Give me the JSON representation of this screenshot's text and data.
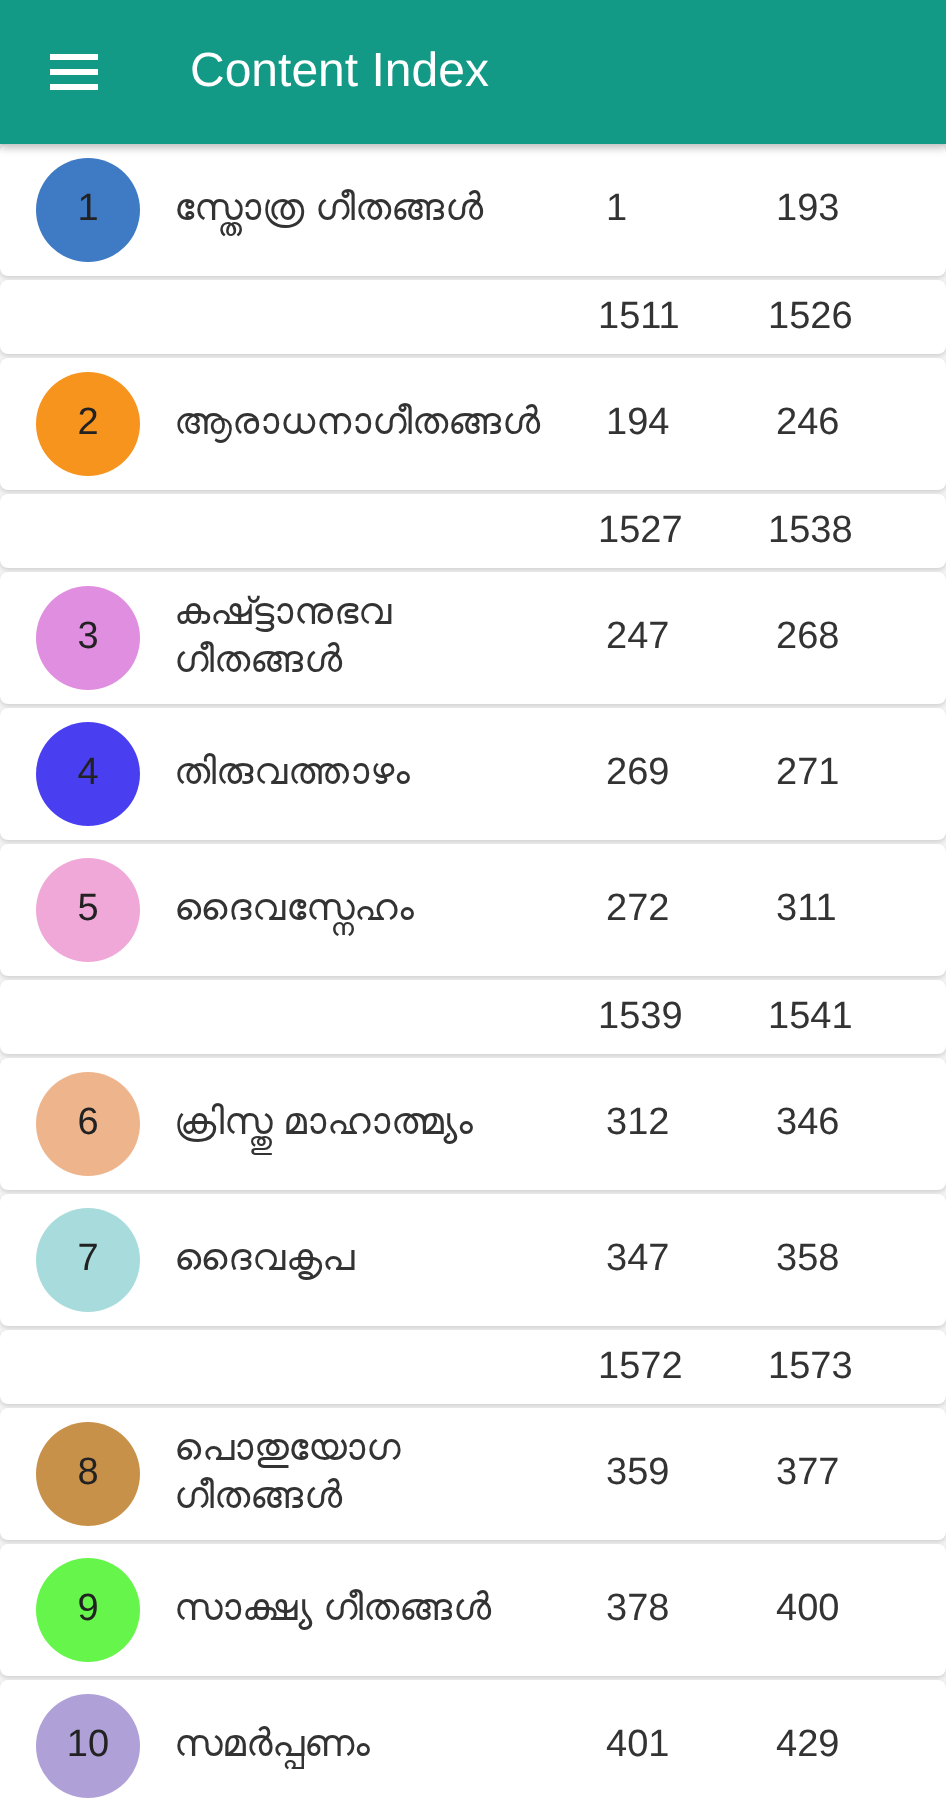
{
  "app_bar": {
    "title": "Content Index"
  },
  "rows": [
    {
      "kind": "category",
      "number": "1",
      "color": "#3f7bc4",
      "title": "സ്തോത്ര ഗീതങ്ങൾ",
      "start": "1",
      "end": "193"
    },
    {
      "kind": "extra",
      "start": "1511",
      "end": "1526"
    },
    {
      "kind": "category",
      "number": "2",
      "color": "#f7941d",
      "title": "ആരാധനാഗീതങ്ങൾ",
      "start": "194",
      "end": "246"
    },
    {
      "kind": "extra",
      "start": "1527",
      "end": "1538"
    },
    {
      "kind": "category",
      "number": "3",
      "color": "#e08ee0",
      "title": "കഷ്ട്ടാനുഭവ ഗീതങ്ങൾ",
      "start": "247",
      "end": "268"
    },
    {
      "kind": "category",
      "number": "4",
      "color": "#4a3ff0",
      "title": "തിരുവത്താഴം",
      "start": "269",
      "end": "271"
    },
    {
      "kind": "category",
      "number": "5",
      "color": "#f0a8d8",
      "title": "ദൈവസ്നേഹം",
      "start": "272",
      "end": "311"
    },
    {
      "kind": "extra",
      "start": "1539",
      "end": "1541"
    },
    {
      "kind": "category",
      "number": "6",
      "color": "#eeb48c",
      "title": "ക്രിസ്തു മാഹാത്മ്യം",
      "start": "312",
      "end": "346"
    },
    {
      "kind": "category",
      "number": "7",
      "color": "#a8dcdc",
      "title": "ദൈവകൃപ",
      "start": "347",
      "end": "358"
    },
    {
      "kind": "extra",
      "start": "1572",
      "end": "1573"
    },
    {
      "kind": "category",
      "number": "8",
      "color": "#c8914a",
      "title": "പൊതുയോഗ ഗീതങ്ങൾ",
      "start": "359",
      "end": "377"
    },
    {
      "kind": "category",
      "number": "9",
      "color": "#66f54a",
      "title": "സാക്ഷ്യ ഗീതങ്ങൾ",
      "start": "378",
      "end": "400"
    },
    {
      "kind": "category",
      "number": "10",
      "color": "#b0a0d8",
      "title": "സമർപ്പണം",
      "start": "401",
      "end": "429"
    }
  ]
}
